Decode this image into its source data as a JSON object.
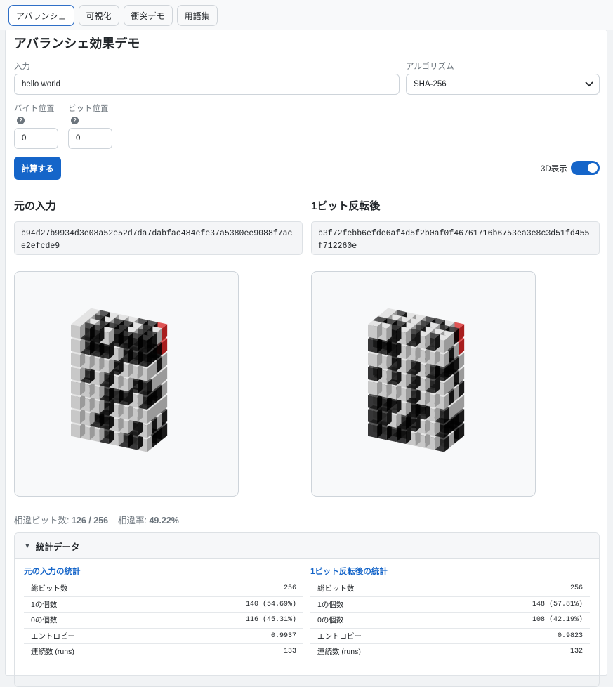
{
  "tabs": [
    "アバランシェ",
    "可視化",
    "衝突デモ",
    "用語集"
  ],
  "title": "アバランシェ効果デモ",
  "input_label": "入力",
  "input_value": "hello world",
  "algo_label": "アルゴリズム",
  "algo_value": "SHA-256",
  "byte_label": "バイト位置",
  "byte_value": "0",
  "bit_label": "ビット位置",
  "bit_value": "0",
  "help_glyph": "?",
  "compute_label": "計算する",
  "toggle_label": "3D表示",
  "left": {
    "heading": "元の入力",
    "hash": "b94d27b9934d3e08a52e52d7da7dabfac484efe37a5380ee9088f7ace2efcde9"
  },
  "right": {
    "heading": "1ビット反転後",
    "hash": "b3f72febb6efde6af4d5f2b0af0f46761716b6753ea3e8c3d51fd455f712260e"
  },
  "diff_bits_label": "相違ビット数:",
  "diff_bits_value": "126 / 256",
  "diff_rate_label": "相違率:",
  "diff_rate_value": "49.22%",
  "stats": {
    "toggle_glyph": "▼",
    "header": "統計データ",
    "left_title": "元の入力の統計",
    "right_title": "1ビット反転後の統計",
    "left_rows": [
      [
        "総ビット数",
        "256"
      ],
      [
        "1の個数",
        "140 (54.69%)"
      ],
      [
        "0の個数",
        "116 (45.31%)"
      ],
      [
        "エントロピー",
        "0.9937"
      ],
      [
        "連続数 (runs)",
        "133"
      ]
    ],
    "right_rows": [
      [
        "総ビット数",
        "256"
      ],
      [
        "1の個数",
        "148 (57.81%)"
      ],
      [
        "0の個数",
        "108 (42.19%)"
      ],
      [
        "エントロピー",
        "0.9823"
      ],
      [
        "連続数 (runs)",
        "132"
      ]
    ]
  },
  "colors": {
    "accent": "#1565c9",
    "flip": "#d32f2f"
  }
}
